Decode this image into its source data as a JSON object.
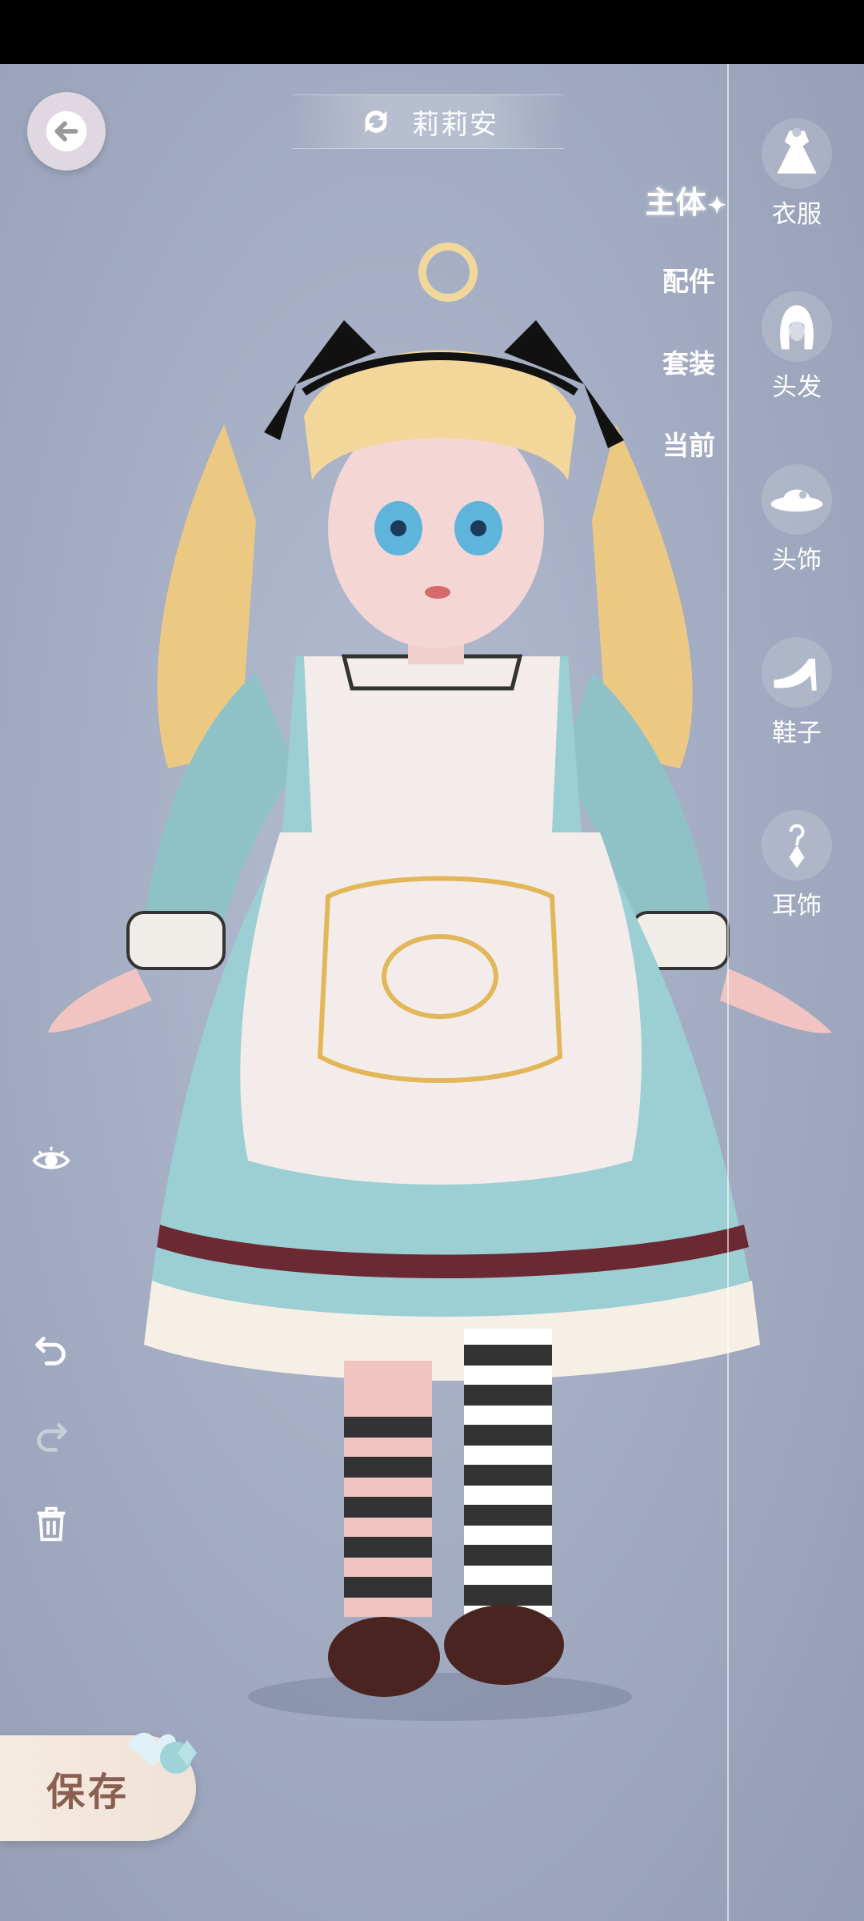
{
  "header": {
    "title": "莉莉安",
    "back_icon": "back-arrow-icon",
    "swap_icon": "refresh-icon"
  },
  "sub_tabs": [
    {
      "label": "主体",
      "active": true
    },
    {
      "label": "配件",
      "active": false
    },
    {
      "label": "套装",
      "active": false
    },
    {
      "label": "当前",
      "active": false
    }
  ],
  "categories": [
    {
      "label": "衣服",
      "icon": "dress-icon"
    },
    {
      "label": "头发",
      "icon": "hair-icon"
    },
    {
      "label": "头饰",
      "icon": "hat-icon"
    },
    {
      "label": "鞋子",
      "icon": "shoe-icon"
    },
    {
      "label": "耳饰",
      "icon": "earring-icon"
    }
  ],
  "tools": [
    "eye-icon",
    "undo-icon",
    "redo-icon",
    "trash-icon"
  ],
  "save": {
    "label": "保存"
  },
  "colors": {
    "background": "#a4adc3",
    "dress": "#9ccfd3",
    "apron": "#f3ecea",
    "hair": "#f3d79a",
    "save_text": "#8a5f52"
  }
}
